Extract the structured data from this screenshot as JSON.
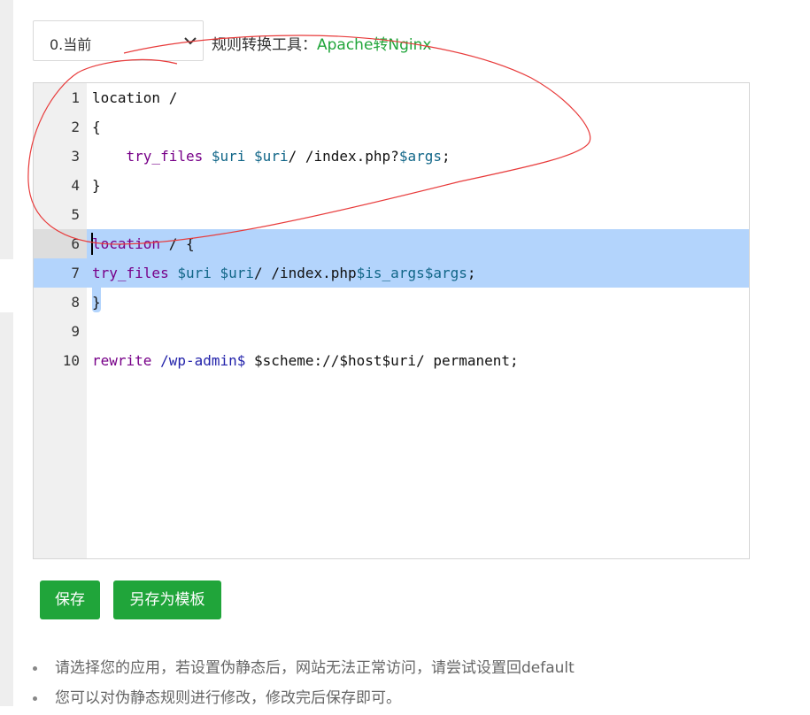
{
  "select": {
    "value": "0.当前"
  },
  "tool": {
    "prefix": "规则转换工具：",
    "link": "Apache转Nginx"
  },
  "editor": {
    "lines": [
      {
        "num": "1",
        "tokens": [
          {
            "t": "location /",
            "c": ""
          }
        ]
      },
      {
        "num": "2",
        "tokens": [
          {
            "t": "{",
            "c": ""
          }
        ]
      },
      {
        "num": "3",
        "tokens": [
          {
            "t": "    ",
            "c": ""
          },
          {
            "t": "try_files",
            "c": "kw"
          },
          {
            "t": " ",
            "c": ""
          },
          {
            "t": "$uri",
            "c": "var"
          },
          {
            "t": " ",
            "c": ""
          },
          {
            "t": "$uri",
            "c": "var"
          },
          {
            "t": "/ /index.php?",
            "c": ""
          },
          {
            "t": "$args",
            "c": "var"
          },
          {
            "t": ";",
            "c": ""
          }
        ]
      },
      {
        "num": "4",
        "tokens": [
          {
            "t": "}",
            "c": ""
          }
        ]
      },
      {
        "num": "5",
        "tokens": []
      },
      {
        "num": "6",
        "tokens": [
          {
            "t": "location",
            "c": "kw"
          },
          {
            "t": " / {",
            "c": ""
          }
        ]
      },
      {
        "num": "7",
        "tokens": [
          {
            "t": "try_files",
            "c": "kw"
          },
          {
            "t": " ",
            "c": ""
          },
          {
            "t": "$uri",
            "c": "var"
          },
          {
            "t": " ",
            "c": ""
          },
          {
            "t": "$uri",
            "c": "var"
          },
          {
            "t": "/ /index.php",
            "c": ""
          },
          {
            "t": "$is_args",
            "c": "var"
          },
          {
            "t": "$args",
            "c": "var"
          },
          {
            "t": ";",
            "c": ""
          }
        ]
      },
      {
        "num": "8",
        "tokens": [
          {
            "t": "}",
            "c": ""
          }
        ]
      },
      {
        "num": "9",
        "tokens": []
      },
      {
        "num": "10",
        "tokens": [
          {
            "t": "rewrite",
            "c": "kw"
          },
          {
            "t": " ",
            "c": ""
          },
          {
            "t": "/wp-admin$",
            "c": "re"
          },
          {
            "t": " $scheme://$host$uri/ permanent;",
            "c": ""
          }
        ]
      }
    ]
  },
  "buttons": {
    "save": "保存",
    "save_template": "另存为模板"
  },
  "tips": [
    "请选择您的应用，若设置伪静态后，网站无法正常访问，请尝试设置回default",
    "您可以对伪静态规则进行修改，修改完后保存即可。"
  ],
  "colors": {
    "accent": "#20a53a",
    "selection": "#b3d4fc",
    "annotation": "#e83b3b"
  }
}
